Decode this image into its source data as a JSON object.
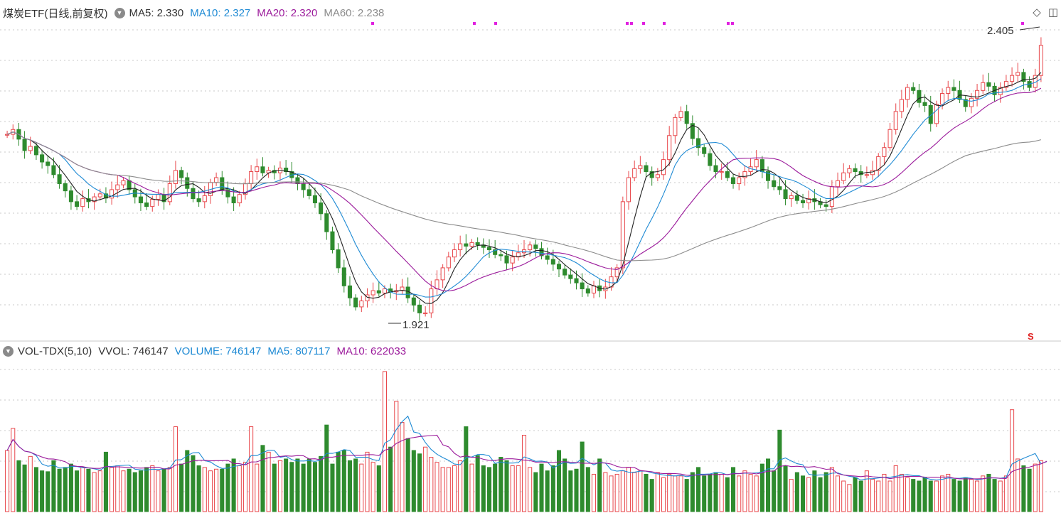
{
  "price_panel": {
    "title": "煤炭ETF(日线,前复权)",
    "ma_labels": [
      {
        "text": "MA5: 2.330",
        "color": "#333333"
      },
      {
        "text": "MA10: 2.327",
        "color": "#1e8ad4"
      },
      {
        "text": "MA20: 2.320",
        "color": "#9b1a9b"
      },
      {
        "text": "MA60: 2.238",
        "color": "#8c8c8c"
      }
    ],
    "max_label": "2.405",
    "min_label": "1.921",
    "marker_label": "S"
  },
  "volume_panel": {
    "labels": [
      {
        "text": "VOL-TDX(5,10)",
        "color": "#333333"
      },
      {
        "text": "VVOL: 746147",
        "color": "#333333"
      },
      {
        "text": "VOLUME: 746147",
        "color": "#1e8ad4"
      },
      {
        "text": "MA5: 807117",
        "color": "#1e8ad4"
      },
      {
        "text": "MA10: 622033",
        "color": "#9b1a9b"
      }
    ]
  },
  "icons": [
    "settings-toggle-icon",
    "diamond-icon",
    "window-icon"
  ],
  "colors": {
    "up": "#e8464a",
    "down": "#2e8b2e",
    "ma5": "#222222",
    "ma10": "#1e8ad4",
    "ma20": "#9b1a9b",
    "ma60": "#8c8c8c",
    "signal": "#e020e0"
  },
  "chart_data": {
    "type": "candlestick",
    "ylim": [
      1.9,
      2.42
    ],
    "vol_max": 1800000,
    "closes": [
      2.232,
      2.24,
      2.224,
      2.205,
      2.212,
      2.198,
      2.186,
      2.18,
      2.165,
      2.15,
      2.138,
      2.12,
      2.112,
      2.125,
      2.12,
      2.128,
      2.133,
      2.126,
      2.14,
      2.148,
      2.155,
      2.14,
      2.128,
      2.118,
      2.112,
      2.124,
      2.132,
      2.12,
      2.15,
      2.172,
      2.16,
      2.142,
      2.125,
      2.12,
      2.13,
      2.152,
      2.16,
      2.14,
      2.128,
      2.118,
      2.132,
      2.15,
      2.17,
      2.178,
      2.168,
      2.172,
      2.168,
      2.176,
      2.17,
      2.16,
      2.15,
      2.14,
      2.13,
      2.118,
      2.1,
      2.07,
      2.04,
      2.01,
      1.98,
      1.96,
      1.945,
      1.955,
      1.965,
      1.972,
      1.968,
      1.975,
      1.97,
      1.972,
      1.978,
      1.96,
      1.948,
      1.935,
      1.935,
      1.975,
      1.99,
      2.01,
      2.028,
      2.04,
      2.05,
      2.046,
      2.052,
      2.048,
      2.044,
      2.04,
      2.032,
      2.03,
      2.018,
      2.028,
      2.035,
      2.04,
      2.048,
      2.042,
      2.03,
      2.024,
      2.016,
      2.008,
      1.998,
      1.992,
      1.985,
      1.975,
      1.968,
      1.98,
      1.972,
      1.978,
      1.995,
      2.01,
      2.12,
      2.16,
      2.175,
      2.18,
      2.17,
      2.16,
      2.165,
      2.19,
      2.23,
      2.26,
      2.27,
      2.25,
      2.225,
      2.21,
      2.2,
      2.18,
      2.17,
      2.17,
      2.16,
      2.15,
      2.16,
      2.17,
      2.178,
      2.19,
      2.17,
      2.155,
      2.145,
      2.14,
      2.125,
      2.13,
      2.122,
      2.118,
      2.125,
      2.12,
      2.115,
      2.112,
      2.145,
      2.155,
      2.168,
      2.175,
      2.17,
      2.165,
      2.165,
      2.172,
      2.195,
      2.21,
      2.24,
      2.27,
      2.29,
      2.31,
      2.305,
      2.285,
      2.28,
      2.25,
      2.282,
      2.3,
      2.31,
      2.305,
      2.29,
      2.278,
      2.292,
      2.305,
      2.318,
      2.312,
      2.298,
      2.31,
      2.32,
      2.33,
      2.335,
      2.32,
      2.31,
      2.33,
      2.38
    ],
    "volumes": [
      720000,
      980000,
      600000,
      550000,
      650000,
      520000,
      480000,
      470000,
      600000,
      500000,
      520000,
      560000,
      480000,
      520000,
      500000,
      460000,
      480000,
      700000,
      520000,
      540000,
      480000,
      500000,
      460000,
      480000,
      520000,
      540000,
      480000,
      500000,
      520000,
      1000000,
      560000,
      720000,
      660000,
      540000,
      520000,
      480000,
      500000,
      500000,
      560000,
      620000,
      540000,
      580000,
      1000000,
      560000,
      780000,
      700000,
      560000,
      600000,
      620000,
      580000,
      620000,
      560000,
      620000,
      580000,
      650000,
      1020000,
      560000,
      700000,
      720000,
      600000,
      620000,
      560000,
      700000,
      580000,
      540000,
      1650000,
      760000,
      1300000,
      1050000,
      860000,
      720000,
      680000,
      760000,
      640000,
      580000,
      520000,
      520000,
      540000,
      600000,
      1000000,
      560000,
      660000,
      540000,
      520000,
      560000,
      640000,
      600000,
      540000,
      540000,
      900000,
      520000,
      460000,
      560000,
      480000,
      540000,
      720000,
      620000,
      480000,
      500000,
      820000,
      520000,
      440000,
      620000,
      460000,
      420000,
      440000,
      480000,
      520000,
      460000,
      480000,
      440000,
      380000,
      460000,
      400000,
      440000,
      420000,
      420000,
      380000,
      460000,
      520000,
      420000,
      440000,
      460000,
      440000,
      400000,
      520000,
      420000,
      480000,
      440000,
      420000,
      560000,
      620000,
      480000,
      960000,
      540000,
      380000,
      460000,
      420000,
      400000,
      480000,
      400000,
      460000,
      520000,
      420000,
      360000,
      320000,
      400000,
      360000,
      480000,
      380000,
      360000,
      440000,
      360000,
      540000,
      440000,
      400000,
      380000,
      360000,
      400000,
      360000,
      360000,
      420000,
      440000,
      380000,
      360000,
      400000,
      380000,
      360000,
      420000,
      440000,
      380000,
      360000,
      420000,
      1200000,
      620000,
      540000,
      500000,
      560000,
      600000,
      746147
    ]
  }
}
